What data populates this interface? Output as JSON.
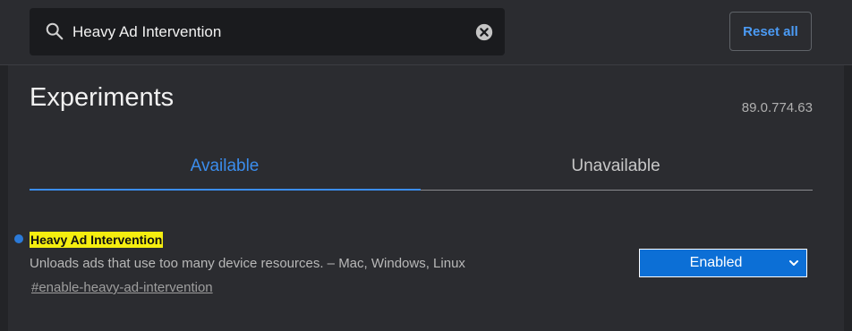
{
  "search": {
    "value": "Heavy Ad Intervention",
    "icon": "search-icon",
    "clear_icon": "close-circle-icon"
  },
  "header": {
    "reset_label": "Reset all"
  },
  "page": {
    "title": "Experiments",
    "version": "89.0.774.63"
  },
  "tabs": [
    {
      "label": "Available",
      "active": true
    },
    {
      "label": "Unavailable",
      "active": false
    }
  ],
  "flags": [
    {
      "name": "Heavy Ad Intervention",
      "description": "Unloads ads that use too many device resources. – Mac, Windows, Linux",
      "link": "#enable-heavy-ad-intervention",
      "state": "Enabled",
      "modified": true
    }
  ],
  "colors": {
    "accent": "#3b8ded",
    "highlight": "#f5ee10",
    "select_bg": "#0c6fd6",
    "background": "#2b2c30"
  }
}
